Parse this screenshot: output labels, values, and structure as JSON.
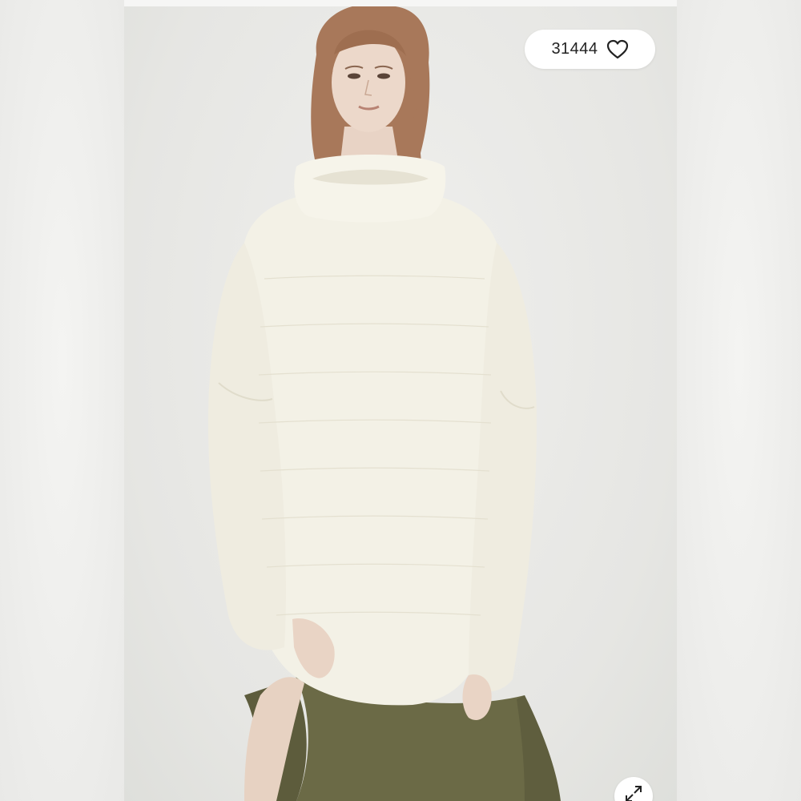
{
  "listing": {
    "like_count": "31444",
    "icons": {
      "like": "heart-outline-icon",
      "expand": "expand-diagonal-arrows-icon"
    },
    "colors": {
      "sweater": "#f3f1e6",
      "skirt": "#6b6a46",
      "background": "#e9e9e6",
      "pill": "#ffffff"
    }
  }
}
